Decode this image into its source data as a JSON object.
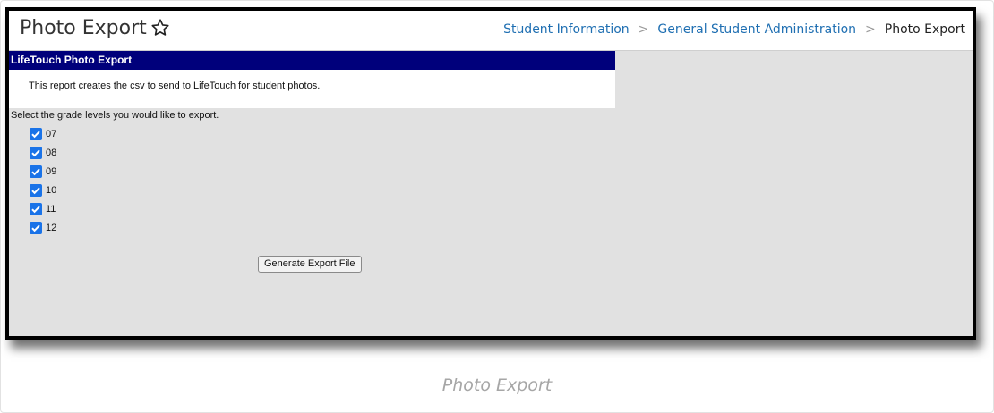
{
  "header": {
    "title": "Photo Export",
    "breadcrumbs": [
      "Student Information",
      "General Student Administration",
      "Photo Export"
    ]
  },
  "panel": {
    "heading": "LifeTouch Photo Export",
    "description": "This report creates the csv to send to LifeTouch for student photos."
  },
  "form": {
    "prompt": "Select the grade levels you would like to export.",
    "grades": [
      {
        "label": "07",
        "checked": true
      },
      {
        "label": "08",
        "checked": true
      },
      {
        "label": "09",
        "checked": true
      },
      {
        "label": "10",
        "checked": true
      },
      {
        "label": "11",
        "checked": true
      },
      {
        "label": "12",
        "checked": true
      }
    ],
    "generate_label": "Generate Export File"
  },
  "caption": "Photo Export",
  "colors": {
    "panel_header": "#00007b",
    "checkbox": "#1a73e8",
    "link": "#1f6fb2"
  }
}
